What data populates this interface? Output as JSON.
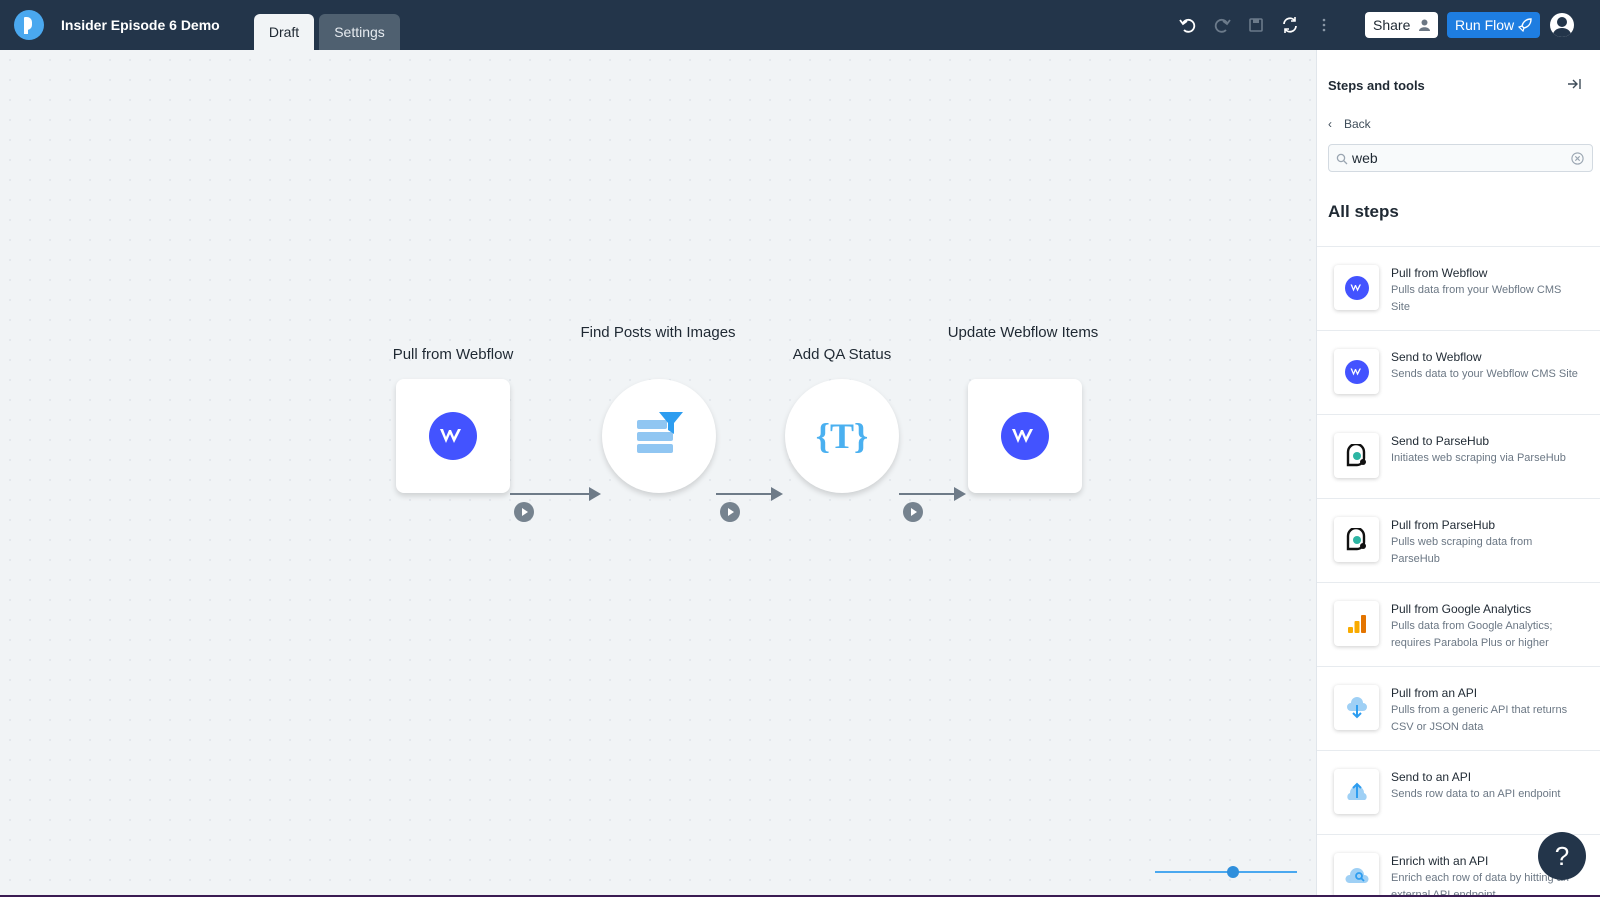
{
  "header": {
    "app_title": "Insider Episode 6 Demo",
    "tabs": [
      {
        "label": "Draft",
        "active": true
      },
      {
        "label": "Settings",
        "active": false
      }
    ],
    "toolbar_icons": [
      "undo-icon",
      "redo-icon",
      "save-icon",
      "refresh-icon",
      "more-vertical-icon"
    ],
    "share_label": "Share",
    "run_label": "Run Flow"
  },
  "flow": {
    "nodes": [
      {
        "label": "Pull from Webflow",
        "icon": "webflow-icon",
        "shape": "square"
      },
      {
        "label": "Find Posts with Images",
        "icon": "filter-icon",
        "shape": "circle"
      },
      {
        "label": "Add QA Status",
        "icon": "text-template-icon",
        "shape": "circle"
      },
      {
        "label": "Update Webflow Items",
        "icon": "webflow-icon",
        "shape": "square"
      }
    ],
    "zoom_level": 0.55
  },
  "sidebar": {
    "title": "Steps and tools",
    "back_label": "Back",
    "search_value": "web",
    "heading": "All steps",
    "steps": [
      {
        "name": "Pull from Webflow",
        "desc": "Pulls data from your Webflow CMS Site",
        "icon": "webflow-icon"
      },
      {
        "name": "Send to Webflow",
        "desc": "Sends data to your Webflow CMS Site",
        "icon": "webflow-icon"
      },
      {
        "name": "Send to ParseHub",
        "desc": "Initiates web scraping via ParseHub",
        "icon": "parsehub-icon"
      },
      {
        "name": "Pull from ParseHub",
        "desc": "Pulls web scraping data from ParseHub",
        "icon": "parsehub-icon"
      },
      {
        "name": "Pull from Google Analytics",
        "desc": "Pulls data from Google Analytics; requires Parabola Plus or higher",
        "icon": "google-analytics-icon"
      },
      {
        "name": "Pull from an API",
        "desc": "Pulls from a generic API that returns CSV or JSON data",
        "icon": "cloud-download-icon"
      },
      {
        "name": "Send to an API",
        "desc": "Sends row data to an API endpoint",
        "icon": "cloud-upload-icon"
      },
      {
        "name": "Enrich with an API",
        "desc": "Enrich each row of data by hitting an external API endpoint",
        "icon": "cloud-search-icon"
      }
    ]
  },
  "help_label": "?",
  "colors": {
    "topbar": "#23354a",
    "accent": "#1e7de0",
    "webflow": "#4353ff"
  }
}
